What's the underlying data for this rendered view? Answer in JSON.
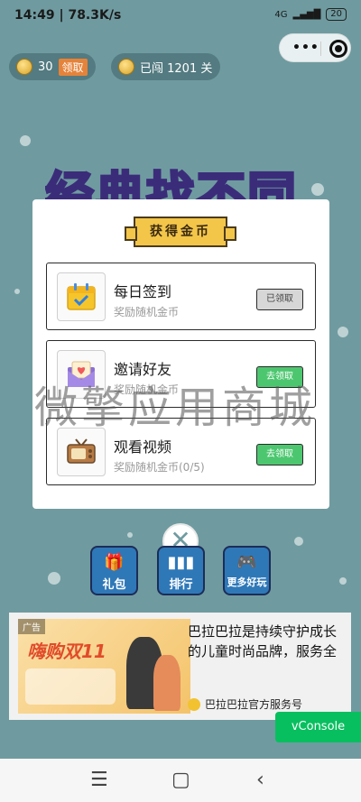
{
  "status": {
    "time": "14:49",
    "speed": "78.3K/s",
    "network": "4G",
    "battery": "20"
  },
  "capsule": {
    "more_icon": "more-dots-icon",
    "close_icon": "target-close-icon"
  },
  "top": {
    "coins": "30",
    "claim": "领取",
    "level": "已闯 1201 关"
  },
  "logo": {
    "text": "经典找不同"
  },
  "modal": {
    "title": "获得金币",
    "tasks": [
      {
        "name": "每日签到",
        "desc": "奖励随机金币",
        "button": "已领取",
        "state": "done"
      },
      {
        "name": "邀请好友",
        "desc": "奖励随机金币",
        "button": "去领取",
        "state": "available"
      },
      {
        "name": "观看视频",
        "desc": "奖励随机金币(0/5)",
        "button": "去领取",
        "state": "available"
      }
    ]
  },
  "close": {
    "symbol": "✕"
  },
  "game_buttons": [
    {
      "label": "礼包",
      "icon": "gift-icon"
    },
    {
      "label": "排行",
      "icon": "rank-icon"
    },
    {
      "label": "更多好玩",
      "icon": "gamepad-icon"
    }
  ],
  "ad": {
    "tag": "广告",
    "headline": "嗨购双11",
    "copy": "巴拉巴拉是持续守护成长的儿童时尚品牌，服务全",
    "brand": "巴拉巴拉官方服务号"
  },
  "watermark": "微擎应用商城",
  "vconsole": "vConsole",
  "colors": {
    "background": "#6f9ba0",
    "button_green": "#4cc76f",
    "button_gray": "#d7d7d7",
    "title_gold": "#f3c64a",
    "game_button_blue": "#2f78b8",
    "vconsole_green": "#08bf5f"
  }
}
